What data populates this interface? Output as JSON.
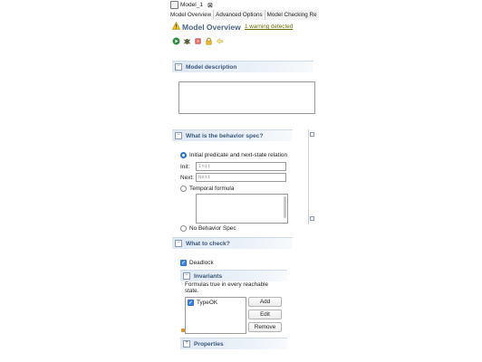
{
  "editor_tab": {
    "label": "Model_1",
    "close_glyph": "⊠"
  },
  "tabs": [
    {
      "label": "Model Overview"
    },
    {
      "label": "Advanced Options"
    },
    {
      "label": "Model Checking Re"
    }
  ],
  "header": {
    "title": "Model Overview",
    "warning_link": "1 warning detected"
  },
  "toolbar": {
    "icons": [
      "run-icon",
      "debug-icon",
      "stop-icon",
      "lock-icon",
      "back-arrow-icon"
    ]
  },
  "model_description": {
    "title": "Model description",
    "value": ""
  },
  "behavior": {
    "title": "What is the behavior spec?",
    "option_init_next": "Initial predicate and next-state relation",
    "init_label": "Init:",
    "init_placeholder": "Init",
    "next_label": "Next:",
    "next_placeholder": "Next",
    "option_temporal": "Temporal formula",
    "option_none": "No Behavior Spec",
    "selected": "init_next"
  },
  "what_to_check": {
    "title": "What to check?",
    "deadlock_label": "Deadlock",
    "deadlock_checked": true,
    "invariants": {
      "title": "Invariants",
      "description": "Formulas true in every reachable state.",
      "items": [
        {
          "label": "TypeOK",
          "checked": true
        }
      ],
      "buttons": {
        "add": "Add",
        "edit": "Edit",
        "remove": "Remove"
      }
    },
    "properties_title": "Properties"
  },
  "colors": {
    "section_title": "#3c5a7a",
    "page_title": "#4a6484",
    "accent": "#3b85e0"
  }
}
